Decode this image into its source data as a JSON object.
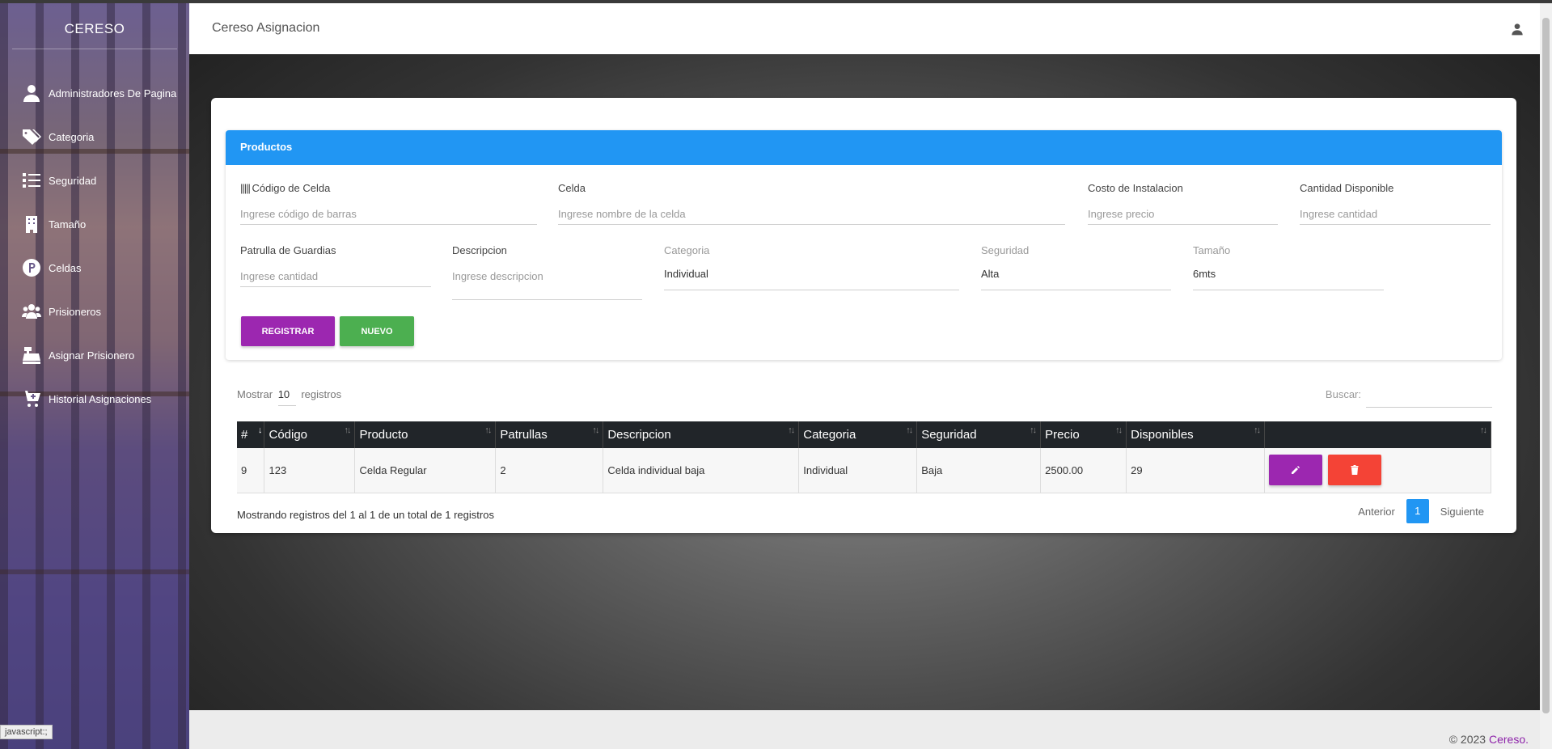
{
  "sidebar": {
    "brand": "CERESO",
    "items": [
      {
        "label": "Administradores De Pagina",
        "icon": "user-icon"
      },
      {
        "label": "Categoria",
        "icon": "tags-icon"
      },
      {
        "label": "Seguridad",
        "icon": "list-icon"
      },
      {
        "label": "Tamaño",
        "icon": "building-icon"
      },
      {
        "label": "Celdas",
        "icon": "parking-icon"
      },
      {
        "label": "Prisioneros",
        "icon": "users-icon"
      },
      {
        "label": "Asignar Prisionero",
        "icon": "cash-register-icon"
      },
      {
        "label": "Historial Asignaciones",
        "icon": "cart-plus-icon"
      }
    ]
  },
  "status_tip": "javascript:;",
  "header": {
    "title": "Cereso Asignacion"
  },
  "panel": {
    "title": "Productos"
  },
  "form": {
    "codigo": {
      "label": "Código de Celda",
      "placeholder": "Ingrese código de barras"
    },
    "celda": {
      "label": "Celda",
      "placeholder": "Ingrese nombre de la celda"
    },
    "costo": {
      "label": "Costo de Instalacion",
      "placeholder": "Ingrese precio"
    },
    "cantidad": {
      "label": "Cantidad Disponible",
      "placeholder": "Ingrese cantidad"
    },
    "patrulla": {
      "label": "Patrulla de Guardias",
      "placeholder": "Ingrese cantidad"
    },
    "descripcion": {
      "label": "Descripcion",
      "placeholder": "Ingrese descripcion"
    },
    "categoria": {
      "label": "Categoria",
      "value": "Individual"
    },
    "seguridad": {
      "label": "Seguridad",
      "value": "Alta"
    },
    "tamano": {
      "label": "Tamaño",
      "value": "6mts"
    },
    "registrar": "REGISTRAR",
    "nuevo": "NUEVO"
  },
  "table_controls": {
    "show_prefix": "Mostrar",
    "show_value": "10",
    "show_suffix": "registros",
    "search_label": "Buscar:"
  },
  "table": {
    "headers": [
      "#",
      "Código",
      "Producto",
      "Patrullas",
      "Descripcion",
      "Categoria",
      "Seguridad",
      "Precio",
      "Disponibles",
      ""
    ],
    "rows": [
      [
        "9",
        "123",
        "Celda Regular",
        "2",
        "Celda individual baja",
        "Individual",
        "Baja",
        "2500.00",
        "29"
      ]
    ]
  },
  "table_info": "Mostrando registros del 1 al 1 de un total de 1 registros",
  "pagination": {
    "prev": "Anterior",
    "current": "1",
    "next": "Siguiente"
  },
  "footer": {
    "copyright": "© 2023 ",
    "brand": "Cereso",
    "dot": "."
  },
  "colors": {
    "primary": "#2196f3",
    "purple": "#9c27b0",
    "green": "#4caf50",
    "red": "#f44336",
    "table_head": "#212529"
  }
}
